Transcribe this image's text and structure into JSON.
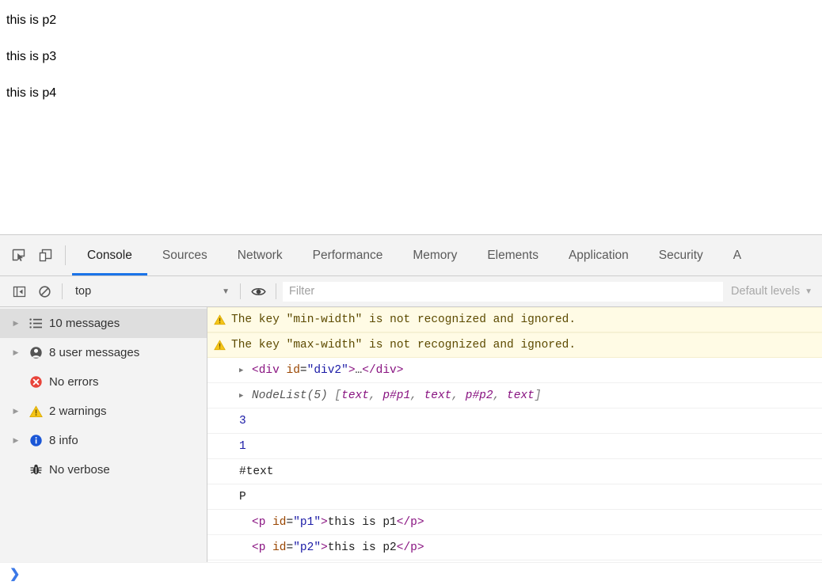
{
  "page": {
    "paragraphs": [
      "this is p2",
      "this is p3",
      "this is p4"
    ]
  },
  "devtools": {
    "tabs": [
      {
        "label": "Console",
        "active": true
      },
      {
        "label": "Sources",
        "active": false
      },
      {
        "label": "Network",
        "active": false
      },
      {
        "label": "Performance",
        "active": false
      },
      {
        "label": "Memory",
        "active": false
      },
      {
        "label": "Elements",
        "active": false
      },
      {
        "label": "Application",
        "active": false
      },
      {
        "label": "Security",
        "active": false
      },
      {
        "label": "A",
        "active": false
      }
    ],
    "toolbar": {
      "inspect_icon": "inspect-element-icon",
      "device_icon": "device-toolbar-icon"
    },
    "filterbar": {
      "sidebar_toggle_icon": "console-sidebar-toggle-icon",
      "clear_icon": "clear-console-icon",
      "context_value": "top",
      "context_caret": "▼",
      "eye_icon": "live-expression-eye-icon",
      "filter_placeholder": "Filter",
      "filter_value": "",
      "levels_label": "Default levels",
      "levels_caret": "▼"
    },
    "sidebar": {
      "items": [
        {
          "label": "10 messages",
          "icon": "list-icon",
          "twisty": true,
          "selected": true
        },
        {
          "label": "8 user messages",
          "icon": "user-icon",
          "twisty": true,
          "selected": false
        },
        {
          "label": "No errors",
          "icon": "error-icon",
          "twisty": false,
          "selected": false
        },
        {
          "label": "2 warnings",
          "icon": "warning-icon",
          "twisty": true,
          "selected": false
        },
        {
          "label": "8 info",
          "icon": "info-icon",
          "twisty": true,
          "selected": false
        },
        {
          "label": "No verbose",
          "icon": "verbose-bug-icon",
          "twisty": false,
          "selected": false
        }
      ]
    },
    "messages": [
      {
        "kind": "warning",
        "icon": "warning-icon",
        "text": "The key \"min-width\" is not recognized and ignored."
      },
      {
        "kind": "warning",
        "icon": "warning-icon",
        "text": "The key \"max-width\" is not recognized and ignored."
      },
      {
        "kind": "dom",
        "twisty": "▶",
        "tokens": [
          {
            "t": "<div ",
            "c": "tag"
          },
          {
            "t": "id",
            "c": "attr"
          },
          {
            "t": "=",
            "c": "plain"
          },
          {
            "t": "\"div2\"",
            "c": "val"
          },
          {
            "t": ">",
            "c": "tag"
          },
          {
            "t": "…",
            "c": "plain"
          },
          {
            "t": "</div>",
            "c": "tag"
          }
        ]
      },
      {
        "kind": "nodelist",
        "twisty": "▶",
        "tokens": [
          {
            "t": "NodeList(5)",
            "c": "nodelist"
          },
          {
            "t": " [",
            "c": "bracket"
          },
          {
            "t": "text",
            "c": "node"
          },
          {
            "t": ", ",
            "c": "bracket"
          },
          {
            "t": "p#p1",
            "c": "node"
          },
          {
            "t": ", ",
            "c": "bracket"
          },
          {
            "t": "text",
            "c": "node"
          },
          {
            "t": ", ",
            "c": "bracket"
          },
          {
            "t": "p#p2",
            "c": "node"
          },
          {
            "t": ", ",
            "c": "bracket"
          },
          {
            "t": "text",
            "c": "node"
          },
          {
            "t": "]",
            "c": "bracket"
          }
        ]
      },
      {
        "kind": "value",
        "tokens": [
          {
            "t": "3",
            "c": "num"
          }
        ]
      },
      {
        "kind": "value",
        "tokens": [
          {
            "t": "1",
            "c": "num"
          }
        ]
      },
      {
        "kind": "value",
        "tokens": [
          {
            "t": "#text",
            "c": "plain"
          }
        ]
      },
      {
        "kind": "value",
        "tokens": [
          {
            "t": "P",
            "c": "plain"
          }
        ]
      },
      {
        "kind": "dom-deep",
        "tokens": [
          {
            "t": "<p ",
            "c": "tag"
          },
          {
            "t": "id",
            "c": "attr"
          },
          {
            "t": "=",
            "c": "plain"
          },
          {
            "t": "\"p1\"",
            "c": "val"
          },
          {
            "t": ">",
            "c": "tag"
          },
          {
            "t": "this is p1",
            "c": "text"
          },
          {
            "t": "</p>",
            "c": "tag"
          }
        ]
      },
      {
        "kind": "dom-deep",
        "tokens": [
          {
            "t": "<p ",
            "c": "tag"
          },
          {
            "t": "id",
            "c": "attr"
          },
          {
            "t": "=",
            "c": "plain"
          },
          {
            "t": "\"p2\"",
            "c": "val"
          },
          {
            "t": ">",
            "c": "tag"
          },
          {
            "t": "this is p2",
            "c": "text"
          },
          {
            "t": "</p>",
            "c": "tag"
          }
        ]
      }
    ],
    "prompt": {
      "chevron": "❯",
      "value": ""
    },
    "colors": {
      "accent": "#1a73e8",
      "warning_bg": "#fffbe5",
      "warning_icon": "#f5c518",
      "error_icon": "#e8443a",
      "info_icon": "#1a73e8",
      "prompt": "#3b78e7"
    }
  }
}
